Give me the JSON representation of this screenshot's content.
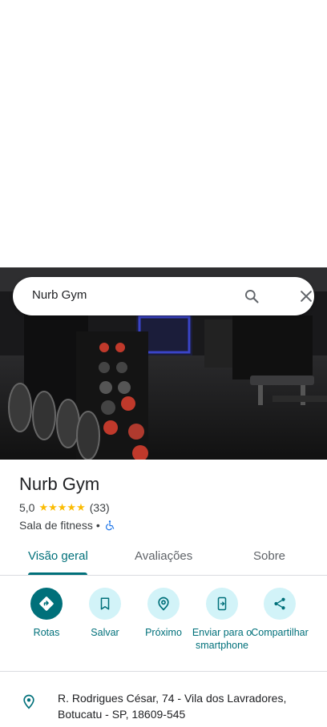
{
  "search": {
    "query": "Nurb Gym"
  },
  "place": {
    "name": "Nurb Gym",
    "rating": "5,0",
    "stars": "★★★★★",
    "review_count": "(33)",
    "category": "Sala de fitness",
    "separator": "•"
  },
  "tabs": [
    {
      "label": "Visão geral"
    },
    {
      "label": "Avaliações"
    },
    {
      "label": "Sobre"
    }
  ],
  "actions": [
    {
      "label": "Rotas"
    },
    {
      "label": "Salvar"
    },
    {
      "label": "Próximo"
    },
    {
      "label": "Enviar para o smartphone"
    },
    {
      "label": "Compartilhar"
    }
  ],
  "address": "R. Rodrigues César, 74 - Vila dos Lavradores, Botucatu - SP, 18609-545",
  "colors": {
    "accent": "#00707a",
    "action_bg": "#d2f3f8",
    "star": "#fbbc04"
  }
}
